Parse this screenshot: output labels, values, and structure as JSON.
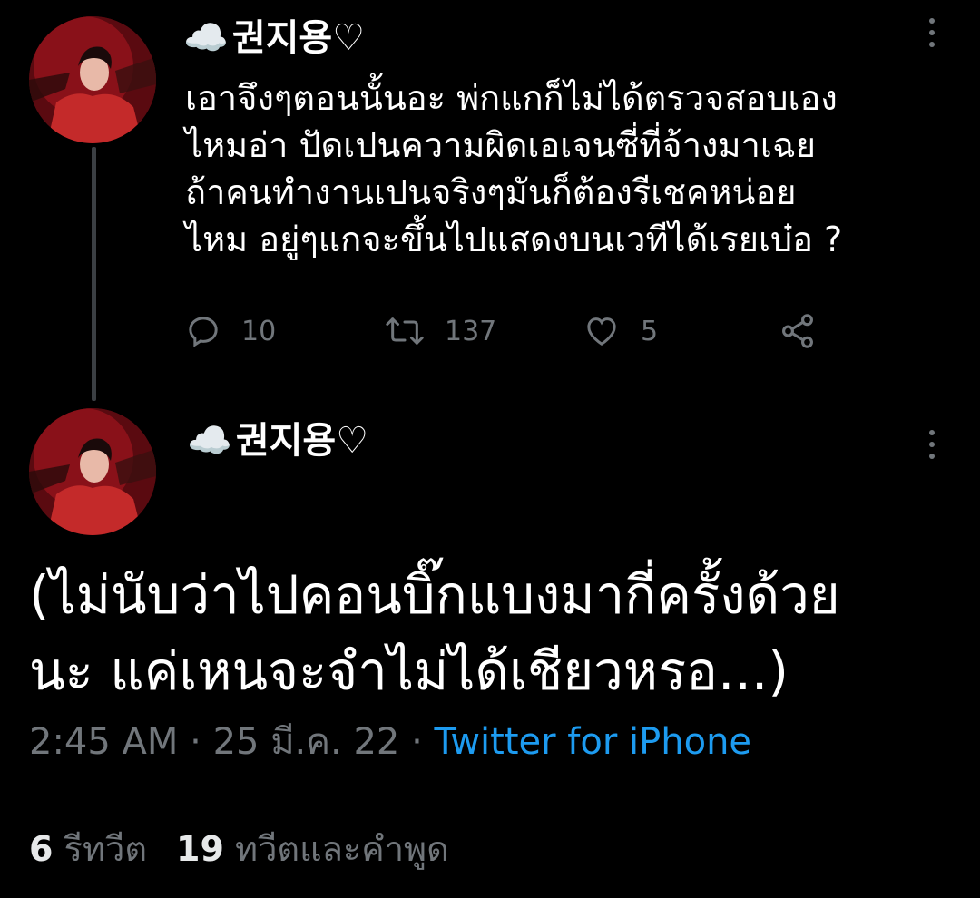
{
  "colors": {
    "background": "#000000",
    "text_primary": "#ffffff",
    "text_secondary": "#71767b",
    "link": "#1d9bf0",
    "thread_line": "#3b3f43",
    "avatar_accent": "#b3202a"
  },
  "tweet1": {
    "author": {
      "emoji": "☁️",
      "name": "권지용♡",
      "avatar_icon": "profile-photo"
    },
    "text_lines": [
      "เอาจึงๆตอนนั้นอะ พ่กแกก็ไม่ได้ตรวจสอบเอง",
      "ไหมอ่า ปัดเปนความผิดเอเจนซี่ที่จ้างมาเฉย",
      "ถ้าคนทำงานเปนจริงๆมันก็ต้องรีเชคหน่อย",
      "ไหม อยู่ๆแกจะขึ้นไปแสดงบนเวทีได้เรยเบ๋อ ?"
    ],
    "actions": {
      "replies": "10",
      "retweets": "137",
      "likes": "5",
      "icons": [
        "reply-icon",
        "retweet-icon",
        "like-icon",
        "share-icon"
      ]
    }
  },
  "tweet2": {
    "author": {
      "emoji": "☁️",
      "name": "권지용♡",
      "avatar_icon": "profile-photo"
    },
    "text_lines": [
      "(ไม่นับว่าไปคอนบิ๊กแบงมากี่ครั้งด้วย",
      "นะ แค่เหนจะจำไม่ได้เชียวหรอ...)"
    ],
    "meta": {
      "time": "2:45 AM",
      "separator": "·",
      "date": "25 มี.ค. 22",
      "source": "Twitter for iPhone"
    },
    "stats": {
      "retweets_count": "6",
      "retweets_label": "รีทวีต",
      "quotes_count": "19",
      "quotes_label": "ทวีตและคำพูด"
    }
  }
}
